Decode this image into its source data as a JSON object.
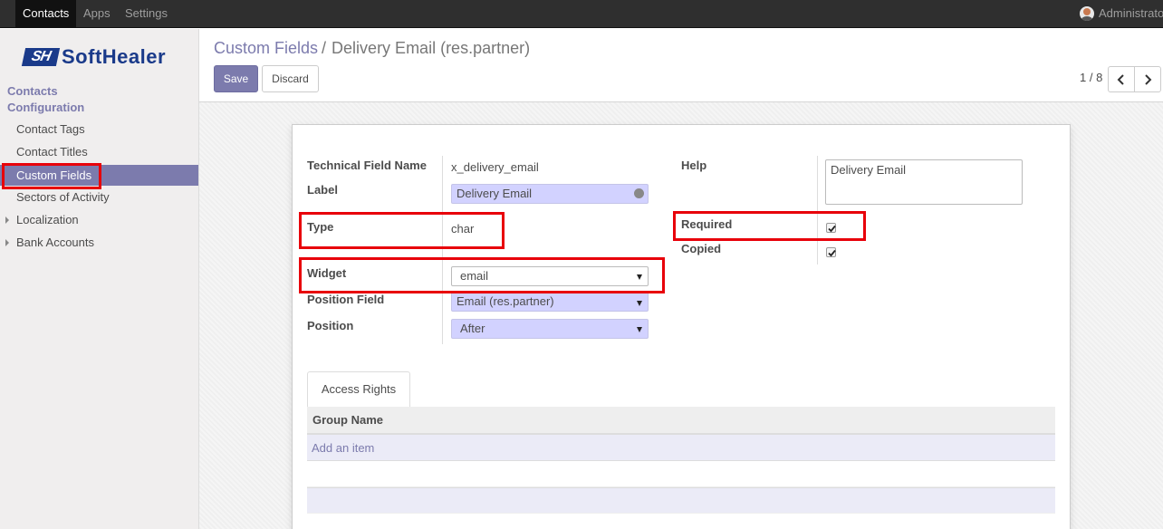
{
  "topbar": {
    "menu": [
      "Contacts",
      "Apps",
      "Settings"
    ],
    "user": "Administrator"
  },
  "sidebar": {
    "logo": {
      "mark": "SH",
      "word": "SoftHealer"
    },
    "heading1": "Contacts",
    "heading2": "Configuration",
    "items": [
      {
        "label": "Contact Tags"
      },
      {
        "label": "Contact Titles"
      },
      {
        "label": "Custom Fields",
        "active": true
      },
      {
        "label": "Sectors of Activity"
      },
      {
        "label": "Localization",
        "collapsible": true
      },
      {
        "label": "Bank Accounts",
        "collapsible": true
      }
    ]
  },
  "control": {
    "breadcrumb_parent": "Custom Fields",
    "breadcrumb_sep": "/",
    "breadcrumb_current": "Delivery Email (res.partner)",
    "save_label": "Save",
    "discard_label": "Discard",
    "pager": "1 / 8"
  },
  "form": {
    "technical_field_name_label": "Technical Field Name",
    "technical_field_name_value": "x_delivery_email",
    "label_label": "Label",
    "label_value": "Delivery Email",
    "type_label": "Type",
    "type_value": "char",
    "widget_label": "Widget",
    "widget_value": "email",
    "position_field_label": "Position Field",
    "position_field_value": "Email (res.partner)",
    "position_label": "Position",
    "position_value": "After",
    "help_label": "Help",
    "help_value": "Delivery Email",
    "required_label": "Required",
    "required_checked": true,
    "copied_label": "Copied",
    "copied_checked": true
  },
  "notebook": {
    "tab_label": "Access Rights",
    "column_header": "Group Name",
    "add_item": "Add an item"
  },
  "colors": {
    "brand": "#7c7bad",
    "highlight": "#e8000a",
    "topbar": "#2f2f2f",
    "required_field": "#d2d2ff"
  }
}
